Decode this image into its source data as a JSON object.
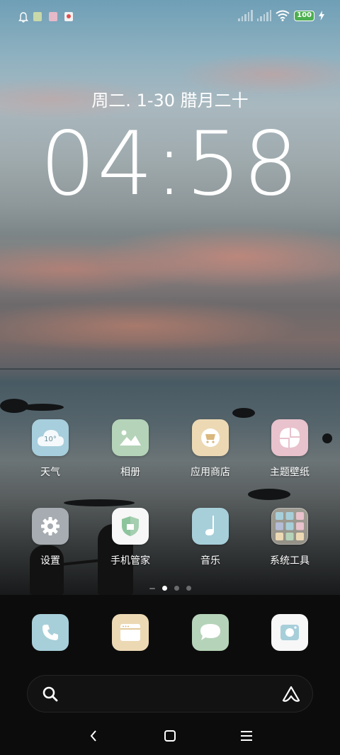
{
  "status_bar": {
    "battery": "100",
    "notification_icons": [
      "bell-icon",
      "green-app-icon",
      "pink-app-icon",
      "red-app-icon"
    ]
  },
  "lockscreen": {
    "date": "周二. 1-30 腊月二十",
    "time": "04:58"
  },
  "apps": {
    "row1": [
      {
        "label": "天气",
        "icon": "weather-icon",
        "icon_text": "10°",
        "color": "#a7cedc"
      },
      {
        "label": "相册",
        "icon": "gallery-icon",
        "color": "#b5d3b8"
      },
      {
        "label": "应用商店",
        "icon": "app-store-icon",
        "color": "#ecd9b4"
      },
      {
        "label": "主题壁纸",
        "icon": "themes-icon",
        "color": "#e8c2cc"
      }
    ],
    "row2": [
      {
        "label": "设置",
        "icon": "settings-icon",
        "color": "#a6acb1"
      },
      {
        "label": "手机管家",
        "icon": "security-shield-icon",
        "color": "#f7f7f7"
      },
      {
        "label": "音乐",
        "icon": "music-icon",
        "color": "#a7cfda"
      },
      {
        "label": "系统工具",
        "icon": "folder-icon",
        "color": "rgba(240,230,210,0.5)"
      }
    ]
  },
  "dock": [
    {
      "icon": "phone-icon",
      "color": "#a7cfda"
    },
    {
      "icon": "browser-icon",
      "color": "#ecd9b4"
    },
    {
      "icon": "messages-icon",
      "color": "#b5d3b8"
    },
    {
      "icon": "camera-icon",
      "color": "#f7f7f7"
    }
  ],
  "search": {
    "left_icon": "search-icon",
    "right_icon": "assistant-icon"
  },
  "navigation": [
    "back-icon",
    "home-icon",
    "menu-icon"
  ]
}
